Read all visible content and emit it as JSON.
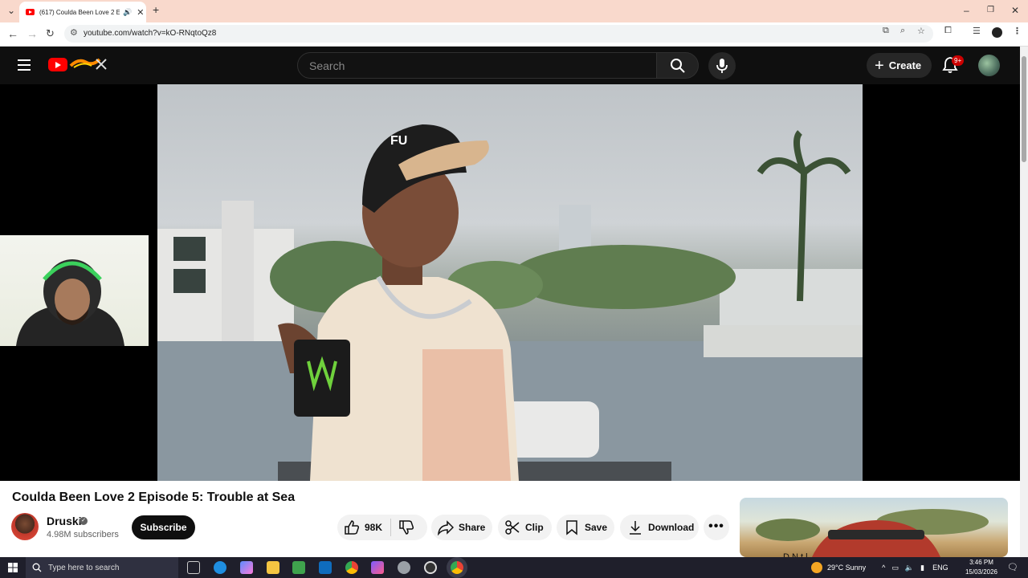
{
  "browser": {
    "tab_title": "(617) Coulda Been Love 2 E",
    "url": "youtube.com/watch?v=kO-RNqtoQz8"
  },
  "youtube": {
    "search_placeholder": "Search",
    "create_label": "Create",
    "notifications_badge": "9+"
  },
  "video": {
    "title": "Coulda Been Love 2 Episode 5: Trouble at Sea",
    "channel_name": "Druski",
    "subscribers": "4.98M subscribers",
    "subscribe_label": "Subscribe",
    "likes": "98K",
    "share_label": "Share",
    "clip_label": "Clip",
    "save_label": "Save",
    "download_label": "Download"
  },
  "sidebar": {
    "next_title_partial": "D          N     t    l"
  },
  "taskbar": {
    "search_placeholder": "Type here to search",
    "weather": "29°C  Sunny",
    "language": "ENG",
    "time": "3:46 PM",
    "date": "15/03/2026"
  },
  "colors": {
    "youtube_red": "#ff0000",
    "masthead_bg": "#0f0f0f",
    "tab_strip": "#f9d9cc",
    "taskbar_bg": "#1f1f2b"
  }
}
